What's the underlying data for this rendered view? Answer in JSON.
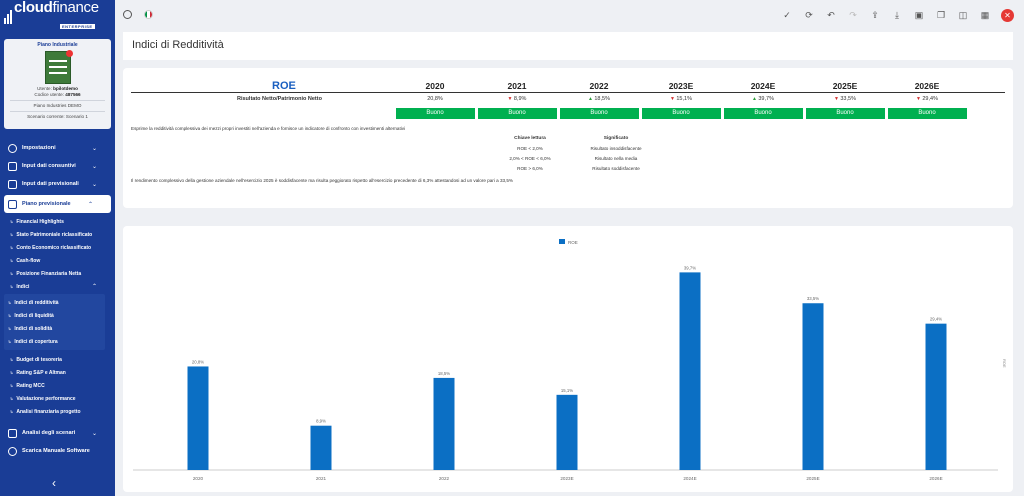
{
  "sidebar": {
    "logo_main": "cloud",
    "logo_light": "finance",
    "logo_sub": "ENTERPRISE",
    "card": {
      "title": "Piano Industriale",
      "badge_text": "PIANO INDUSTRIALE PREMIUM",
      "utente_label": "Utente:",
      "utente_value": "bpilotdemo",
      "codice_label": "Codice utente:",
      "codice_value": "487566",
      "company": "Piano Industries DEMO",
      "scenario": "Scenario corrente: Scenario 1"
    },
    "menu": {
      "impostazioni": "Impostazioni",
      "input_consuntivi": "Input dati consuntivi",
      "input_previsionali": "Input dati previsionali",
      "piano_previsionale": "Piano previsionale",
      "sub": [
        "Financial Highlights",
        "Stato Patrimoniale riclassificato",
        "Conto Economico riclassificato",
        "Cash-flow",
        "Posizione Finanziaria Netta"
      ],
      "indici": "Indici",
      "indici_sub": [
        "Indici di redditività",
        "Indici di liquidità",
        "Indici di solidità",
        "Indici di copertura"
      ],
      "sub2": [
        "Budget di tesoreria",
        "Rating S&P e Altman",
        "Rating MCC",
        "Valutazione performance",
        "Analisi finanziaria progetto"
      ],
      "analisi_scenari": "Analisi degli scenari",
      "scarica": "Scarica Manuale Software"
    }
  },
  "topbar": {
    "icons": [
      "check-icon",
      "refresh-icon",
      "undo-icon",
      "redo-icon",
      "upload-icon",
      "download-icon",
      "save-icon",
      "copy-icon",
      "columns-icon",
      "grid-icon",
      "close-icon"
    ]
  },
  "page": {
    "title": "Indici di Redditività"
  },
  "table": {
    "heading": "ROE",
    "years": [
      "2020",
      "2021",
      "2022",
      "2023E",
      "2024E",
      "2025E",
      "2026E"
    ],
    "row_label": "Risultato Netto/Patrimonio Netto",
    "values": [
      "20,8%",
      "8,9%",
      "18,5%",
      "15,1%",
      "39,7%",
      "33,5%",
      "29,4%"
    ],
    "trends": [
      "",
      "down",
      "up",
      "down",
      "up",
      "down",
      "down"
    ],
    "ratings": [
      "Buono",
      "Buono",
      "Buono",
      "Buono",
      "Buono",
      "Buono",
      "Buono"
    ],
    "description": "Esprime la redditività complessiva dei mezzi propri investiti nell'azienda e fornisce un indicatore di confronto con investimenti alternativi",
    "key_header": "Chiave lettura",
    "meaning_header": "Significato",
    "keys": [
      "ROE < 2,0%",
      "2,0% < ROE < 6,0%",
      "ROE > 6,0%"
    ],
    "meanings": [
      "Risultato insoddisfacente",
      "Risultato nella media",
      "Risultato soddisfacente"
    ],
    "summary": "Il rendimento complessivo della gestione aziendale nell'esercizio 2025 è soddisfacente ma risulta peggiorato rispetto all'esercizio precedente di 6,3% attestandosi ad un valore pari a 33,5%"
  },
  "chart_data": {
    "type": "bar",
    "categories": [
      "2020",
      "2021",
      "2022",
      "2023E",
      "2024E",
      "2025E",
      "2026E"
    ],
    "series": [
      {
        "name": "ROE",
        "values": [
          20.8,
          8.9,
          18.5,
          15.1,
          39.7,
          33.5,
          29.4
        ]
      }
    ],
    "data_labels": [
      "20,8%",
      "8,9%",
      "18,5%",
      "15,1%",
      "39,7%",
      "33,5%",
      "29,4%"
    ],
    "legend": "top-center",
    "y_axis_label": "ROE",
    "ylim": [
      0,
      45
    ],
    "bar_color": "#0b6fc4",
    "grid": false
  }
}
